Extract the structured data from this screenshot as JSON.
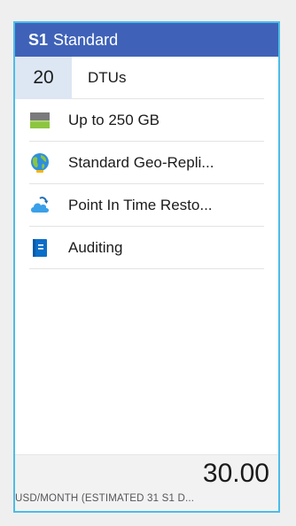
{
  "tier": {
    "code": "S1",
    "name": "Standard"
  },
  "dtu": {
    "value": "20",
    "label": "DTUs"
  },
  "features": [
    {
      "icon": "storage-icon",
      "label": "Up to 250 GB"
    },
    {
      "icon": "globe-icon",
      "label": "Standard Geo-Repli..."
    },
    {
      "icon": "cloud-restore-icon",
      "label": "Point In Time Resto..."
    },
    {
      "icon": "auditing-book-icon",
      "label": "Auditing"
    }
  ],
  "price": {
    "amount": "30.00",
    "note": "USD/MONTH (ESTIMATED 31 S1 D..."
  },
  "colors": {
    "header": "#3f62b8",
    "border": "#4bbde8",
    "dtu_bg": "#dde6f3",
    "footer_bg": "#f2f2f2"
  }
}
